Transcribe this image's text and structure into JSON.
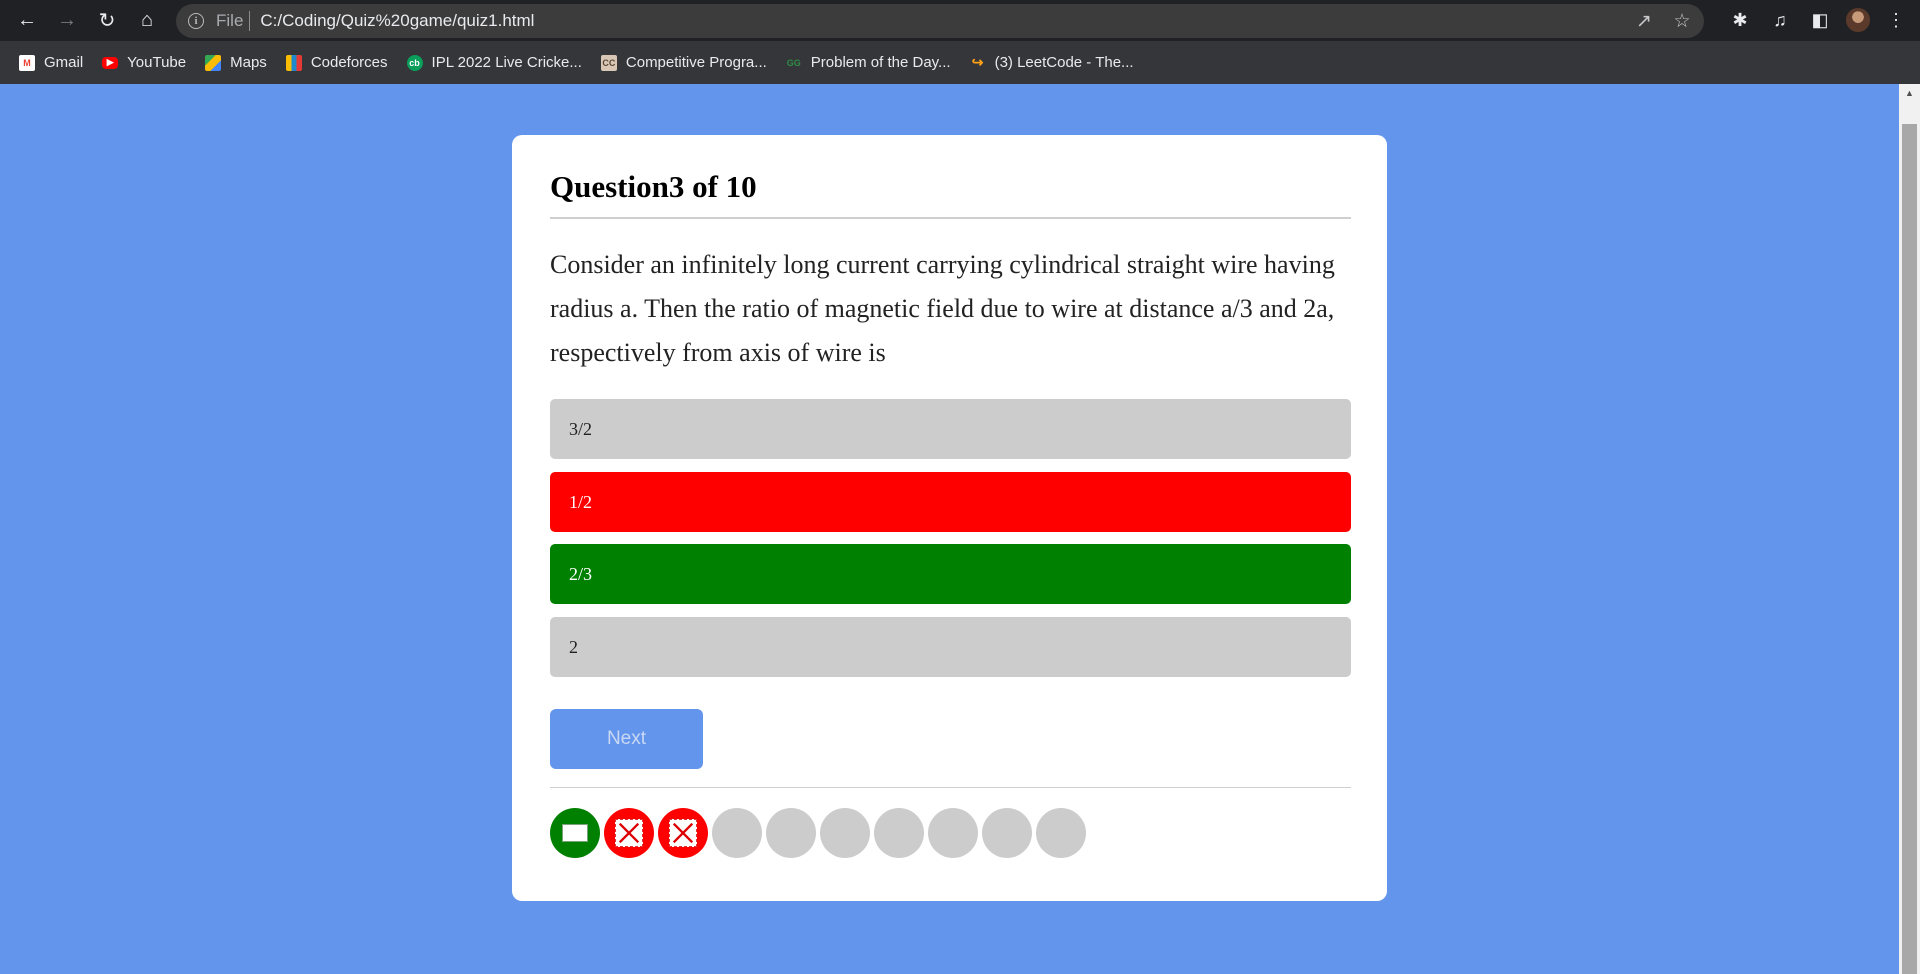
{
  "browser": {
    "address": {
      "scheme_label": "File",
      "url": "C:/Coding/Quiz%20game/quiz1.html"
    },
    "bookmarks": [
      {
        "label": "Gmail",
        "icon": "gmail-icon",
        "color": "#ea4335"
      },
      {
        "label": "YouTube",
        "icon": "youtube-icon",
        "color": "#ff0000"
      },
      {
        "label": "Maps",
        "icon": "maps-icon",
        "color": "#34a853"
      },
      {
        "label": "Codeforces",
        "icon": "codeforces-icon",
        "color": "#1f8acb"
      },
      {
        "label": "IPL 2022 Live Cricke...",
        "icon": "cricbuzz-icon",
        "color": "#0a9e5b"
      },
      {
        "label": "Competitive Progra...",
        "icon": "codechef-icon",
        "color": "#5b4638"
      },
      {
        "label": "Problem of the Day...",
        "icon": "gfg-icon",
        "color": "#2f8d46"
      },
      {
        "label": "(3) LeetCode - The...",
        "icon": "leetcode-icon",
        "color": "#ffa116"
      }
    ]
  },
  "quiz": {
    "title": "Question3 of 10",
    "question": "Consider an infinitely long current carrying cylindrical straight wire having radius a. Then the ratio of magnetic field due to wire at distance a/3 and 2a, respectively from axis of wire is",
    "options": [
      {
        "text": "3/2",
        "state": "default"
      },
      {
        "text": "1/2",
        "state": "wrong"
      },
      {
        "text": "2/3",
        "state": "correct"
      },
      {
        "text": "2",
        "state": "default"
      }
    ],
    "next_label": "Next",
    "progress": [
      "correct",
      "wrong",
      "wrong",
      "unanswered",
      "unanswered",
      "unanswered",
      "unanswered",
      "unanswered",
      "unanswered",
      "unanswered"
    ]
  },
  "colors": {
    "page_bg": "#6495ed",
    "correct": "#008000",
    "wrong": "#ff0000",
    "neutral": "#cccccc"
  }
}
